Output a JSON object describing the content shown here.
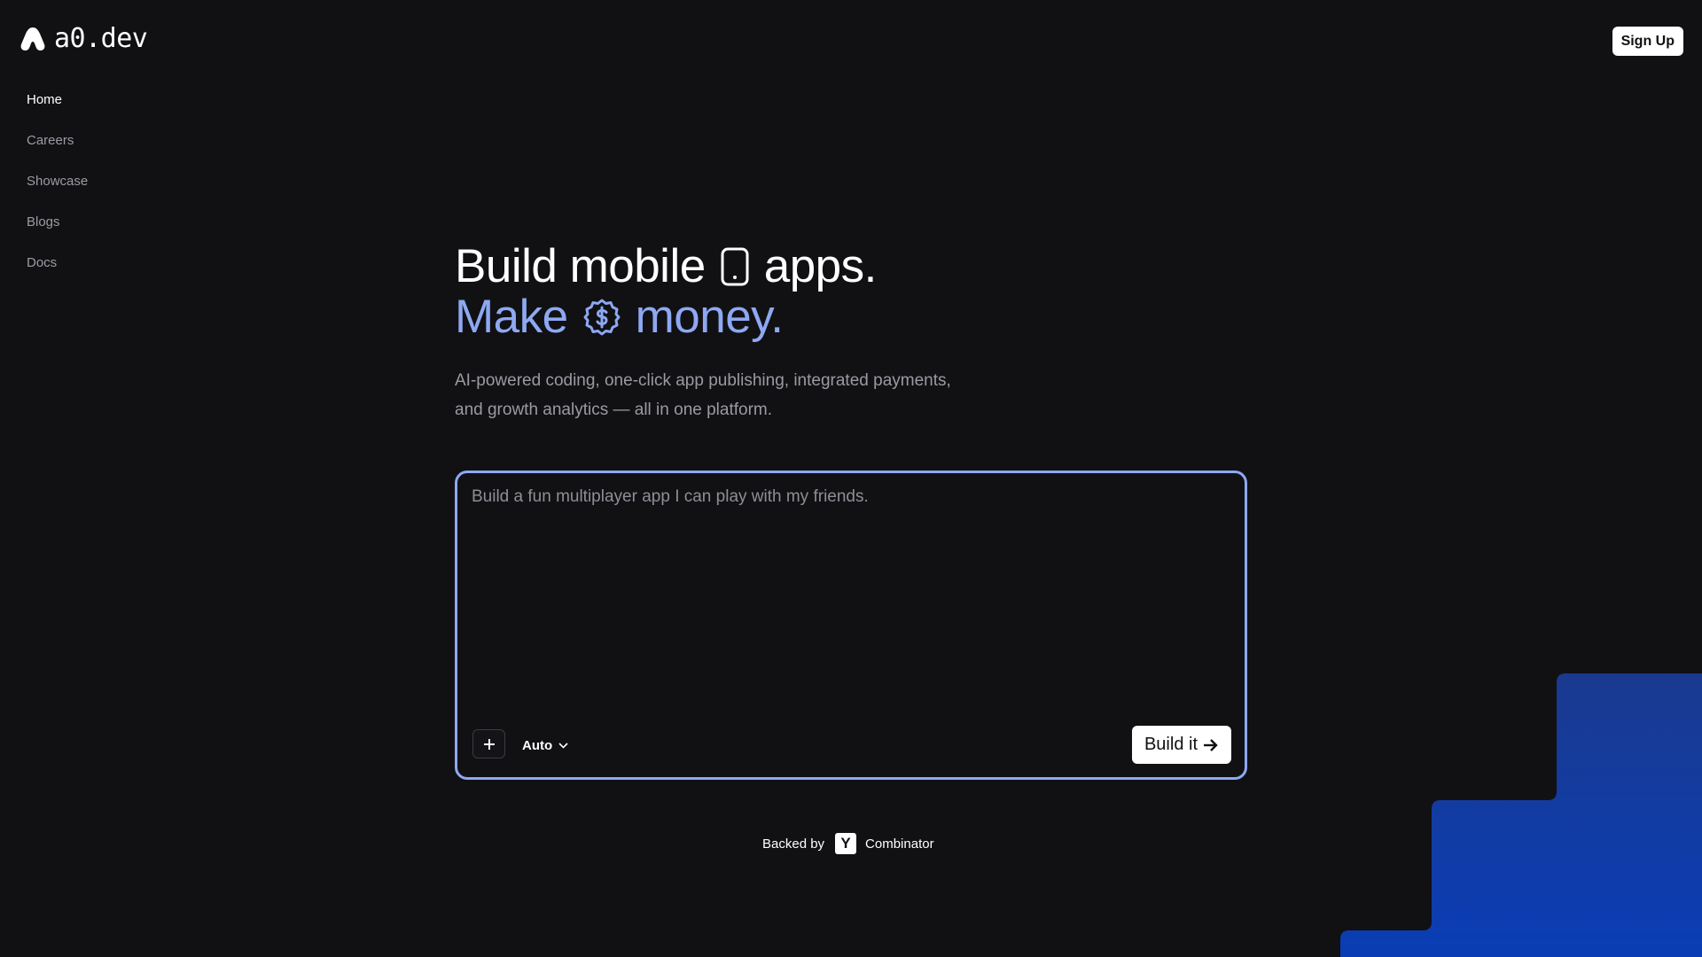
{
  "header": {
    "logo_text": "a0.dev",
    "signup_label": "Sign Up"
  },
  "sidebar": {
    "items": [
      {
        "label": "Home",
        "active": true
      },
      {
        "label": "Careers",
        "active": false
      },
      {
        "label": "Showcase",
        "active": false
      },
      {
        "label": "Blogs",
        "active": false
      },
      {
        "label": "Docs",
        "active": false
      }
    ]
  },
  "hero": {
    "line1_part1": "Build mobile",
    "line1_icon": "phone-icon",
    "line1_part2": "apps.",
    "line2_part1": "Make",
    "line2_icon": "dollar-badge-icon",
    "line2_part2": "money.",
    "subtitle": "AI-powered coding, one-click app publishing, integrated payments, and growth analytics — all in one platform."
  },
  "prompt": {
    "value": "",
    "placeholder": "Build a fun multiplayer app I can play with my friends.",
    "add_icon": "plus-icon",
    "model_label": "Auto",
    "model_icon": "chevron-down-icon",
    "build_label": "Build it",
    "build_icon": "arrow-right-icon"
  },
  "backed_by": {
    "prefix": "Backed by",
    "badge_letter": "Y",
    "name": "Combinator"
  },
  "colors": {
    "background": "#111114",
    "accent": "#8ea8f2",
    "decor_blue": "#0b3aa8"
  }
}
